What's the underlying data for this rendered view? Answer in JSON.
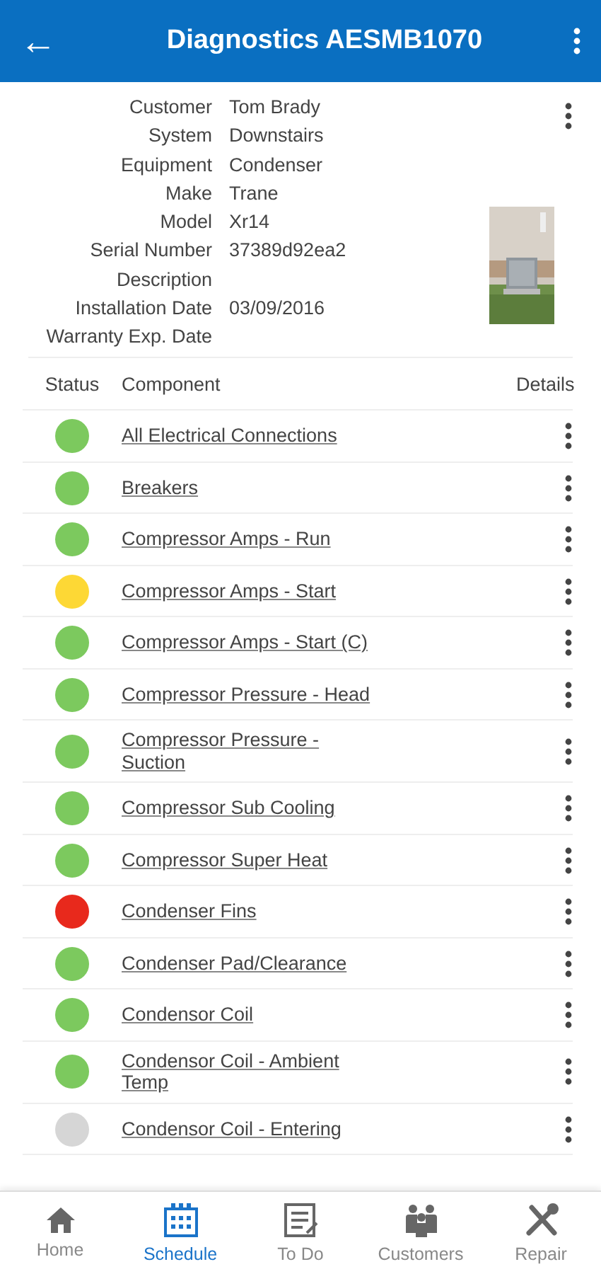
{
  "header": {
    "back_icon": "←",
    "title": "Diagnostics AESMB1070"
  },
  "details": [
    {
      "label": "Customer",
      "value": "Tom Brady"
    },
    {
      "label": "System",
      "value": "Downstairs"
    },
    {
      "label": "Equipment",
      "value": "Condenser"
    },
    {
      "label": "Make",
      "value": "Trane"
    },
    {
      "label": "Model",
      "value": "Xr14"
    },
    {
      "label": "Serial Number",
      "value": "37389d92ea2"
    },
    {
      "label": "Description"
    },
    {
      "label": "Installation Date",
      "value": "03/09/2016"
    },
    {
      "label": "Warranty Exp. Date"
    }
  ],
  "table": {
    "columns": [
      "Status",
      "Component",
      "Details"
    ],
    "rows": [
      {
        "color": "#7cc95e",
        "component": "All Electrical Connections"
      },
      {
        "color": "#7cc95e",
        "component": "Breakers"
      },
      {
        "color": "#7cc95e",
        "component": "Compressor Amps - Run"
      },
      {
        "color": "#fdd835",
        "component": "Compressor Amps - Start"
      },
      {
        "color": "#7cc95e",
        "component": "Compressor Amps - Start (C)"
      },
      {
        "color": "#7cc95e",
        "component": "Compressor Pressure - Head"
      },
      {
        "color": "#7cc95e",
        "component": "Compressor Pressure - Suction"
      },
      {
        "color": "#7cc95e",
        "component": "Compressor Sub Cooling"
      },
      {
        "color": "#7cc95e",
        "component": "Compressor Super Heat"
      },
      {
        "color": "#e8291c",
        "component": "Condenser Fins"
      },
      {
        "color": "#7cc95e",
        "component": "Condenser Pad/Clearance"
      },
      {
        "color": "#7cc95e",
        "component": "Condensor Coil"
      },
      {
        "color": "#7cc95e",
        "component": "Condensor Coil - Ambient Temp"
      },
      {
        "color": "#d6d6d6",
        "component": "Condensor Coil - Entering"
      }
    ]
  },
  "bottom_nav": [
    {
      "kind": "home",
      "label": "Home",
      "selected": false
    },
    {
      "kind": "schedule",
      "label": "Schedule",
      "selected": true
    },
    {
      "kind": "todo",
      "label": "To Do",
      "selected": false
    },
    {
      "kind": "customers",
      "label": "Customers",
      "selected": false
    },
    {
      "kind": "repair",
      "label": "Repair",
      "selected": false
    }
  ]
}
